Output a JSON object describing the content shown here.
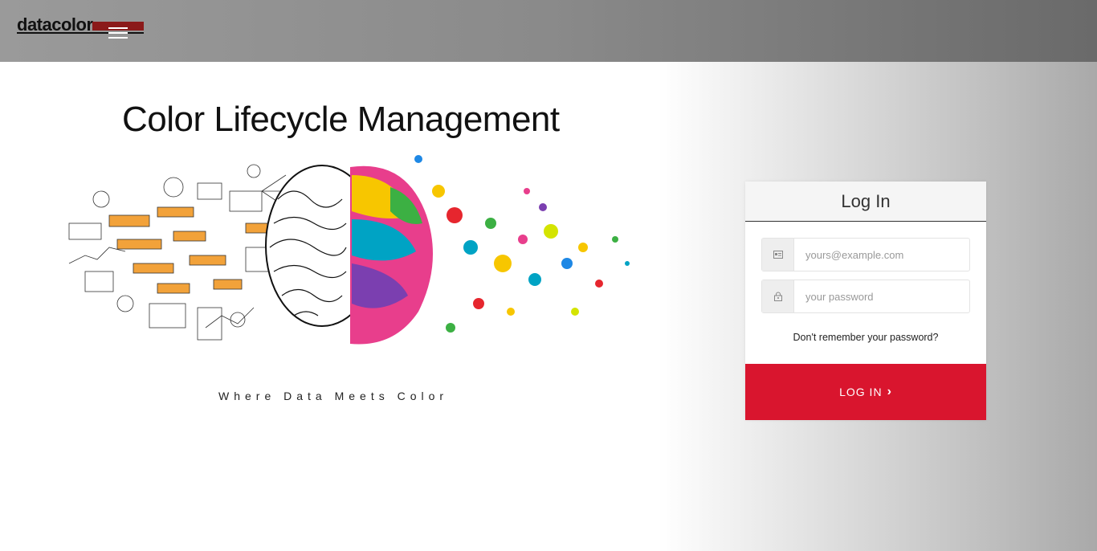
{
  "header": {
    "logo_text": "datacolor",
    "brand_color": "#8b1a1a",
    "menu_icon": "hamburger-menu-icon"
  },
  "hero": {
    "title": "Color Lifecycle Management",
    "tagline": "Where Data Meets Color",
    "image_icon": "brain-illustration"
  },
  "login": {
    "title": "Log In",
    "email_placeholder": "yours@example.com",
    "password_placeholder": "your password",
    "email_icon": "id-card-icon",
    "password_icon": "lock-icon",
    "forgot_label": "Don't remember your password?",
    "submit_label": "LOG IN",
    "submit_icon": "chevron-right-icon",
    "accent_color": "#d9152e"
  }
}
